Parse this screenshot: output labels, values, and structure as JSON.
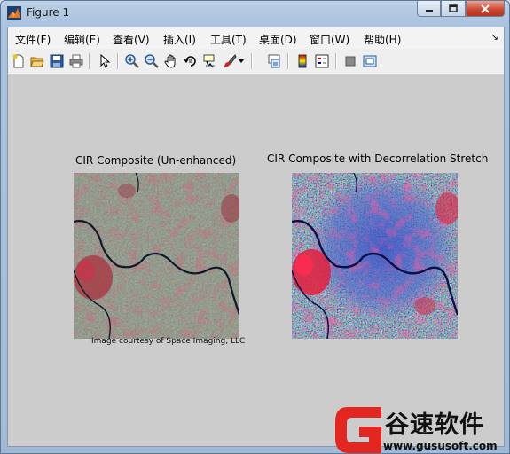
{
  "window": {
    "title": "Figure 1",
    "caption_buttons": [
      "minimize",
      "maximize",
      "close"
    ]
  },
  "menubar": {
    "items": [
      "文件(F)",
      "编辑(E)",
      "查看(V)",
      "插入(I)",
      "工具(T)",
      "桌面(D)",
      "窗口(W)",
      "帮助(H)"
    ],
    "overflow_icon": "chevron-icon"
  },
  "toolbar": {
    "buttons": [
      "new-figure-icon",
      "open-file-icon",
      "save-icon",
      "print-icon",
      "edit-plot-icon",
      "zoom-in-icon",
      "zoom-out-icon",
      "pan-icon",
      "rotate-3d-icon",
      "data-cursor-icon",
      "brush-icon",
      "link-plot-icon",
      "colorbar-icon",
      "legend-icon",
      "hide-plot-tools-icon",
      "show-plot-tools-icon"
    ]
  },
  "figure": {
    "left_title": "CIR Composite (Un-enhanced)",
    "right_title": "CIR Composite with Decorrelation Stretch",
    "credit": "Image courtesy of Space Imaging, LLC"
  },
  "watermark": {
    "text": "谷速软件",
    "url": "www.gususoft.com",
    "accent": "#e3261f"
  }
}
